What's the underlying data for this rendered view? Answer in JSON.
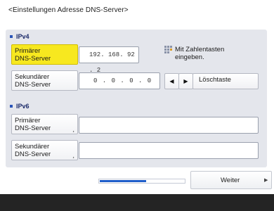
{
  "screen": {
    "title": "<Einstellungen Adresse DNS-Server>"
  },
  "ipv4": {
    "heading": "IPv4",
    "primary": {
      "label_line1": "Primärer",
      "label_line2": "DNS-Server",
      "value": "192. 168. 92 . 2"
    },
    "secondary": {
      "label_line1": "Sekundärer",
      "label_line2": "DNS-Server",
      "value": "0 . 0 . 0 . 0"
    },
    "hint_line1": "Mit Zahlentasten",
    "hint_line2": "eingeben.",
    "hint_icon": "numeric-keypad-icon",
    "left_arrow": "◀",
    "right_arrow": "▶",
    "backspace_label": "Löschtaste"
  },
  "ipv6": {
    "heading": "IPv6",
    "primary": {
      "label_line1": "Primärer",
      "label_line2": "DNS-Server",
      "value": ""
    },
    "secondary": {
      "label_line1": "Sekundärer",
      "label_line2": "DNS-Server",
      "value": ""
    },
    "dropdown_marker": "¸"
  },
  "footer": {
    "progress_fraction": 0.55,
    "next_label": "Weiter",
    "next_arrow": "▶"
  },
  "colors": {
    "active_yellow": "#f7e81f",
    "panel_bg": "#e4e6ec",
    "progress_blue": "#1f5ec9",
    "footer_bar": "#242424"
  }
}
